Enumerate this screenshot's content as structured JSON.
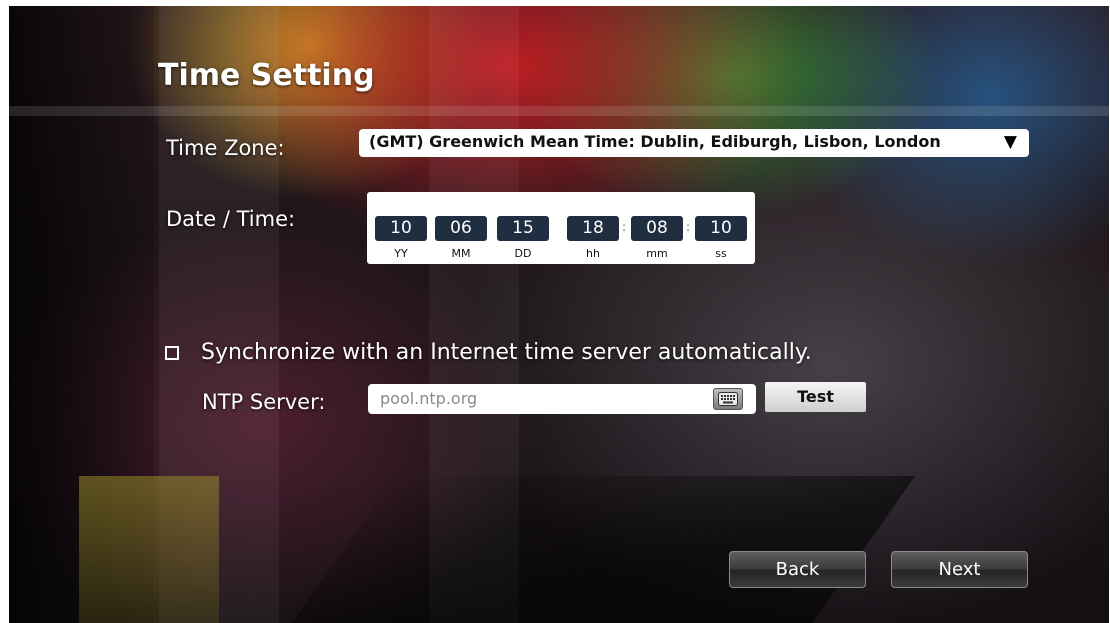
{
  "header": {
    "title": "Time Setting"
  },
  "time_zone": {
    "label": "Time Zone:",
    "selected": "(GMT) Greenwich Mean Time: Dublin, Ediburgh, Lisbon, London",
    "arrow": "▼"
  },
  "date_time": {
    "label": "Date / Time:",
    "fields": [
      {
        "value": "10",
        "unit": "YY"
      },
      {
        "value": "06",
        "unit": "MM"
      },
      {
        "value": "15",
        "unit": "DD"
      },
      {
        "value": "18",
        "unit": "hh"
      },
      {
        "value": "08",
        "unit": "mm"
      },
      {
        "value": "10",
        "unit": "ss"
      }
    ],
    "separator": ":"
  },
  "sync": {
    "label": "Synchronize with an Internet time server automatically.",
    "checked": false
  },
  "ntp": {
    "label": "NTP Server:",
    "placeholder": "pool.ntp.org",
    "keyboard_icon": "keyboard-icon",
    "test_label": "Test"
  },
  "nav": {
    "back_label": "Back",
    "next_label": "Next"
  },
  "colors": {
    "field_bg": "#1f2e40",
    "button_dark": "#3a3a3a",
    "text": "#ffffff"
  }
}
